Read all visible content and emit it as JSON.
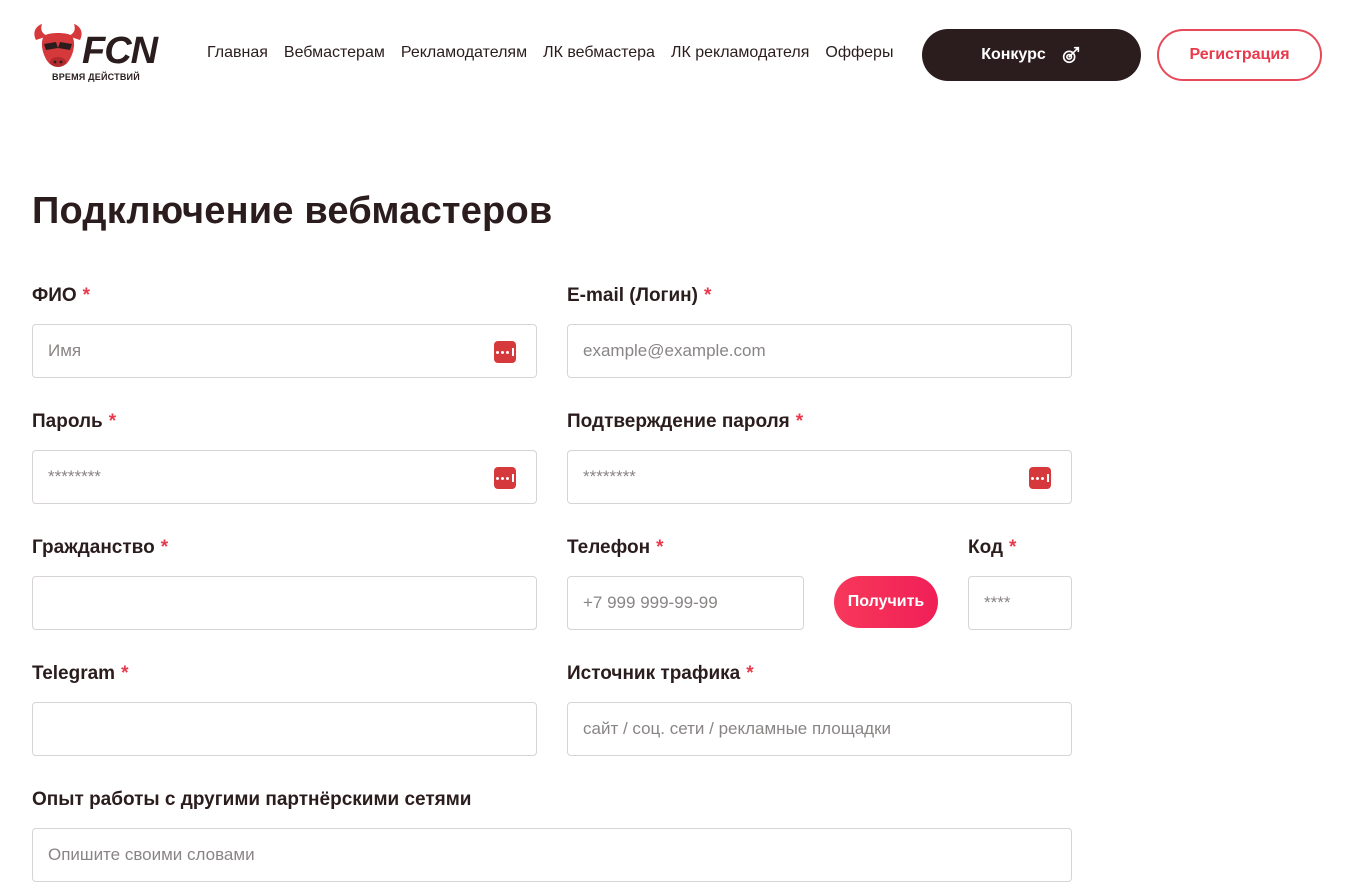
{
  "header": {
    "logo": {
      "brand": "FCN",
      "tagline": "ВРЕМЯ ДЕЙСТВИЙ"
    },
    "nav": [
      {
        "label": "Главная"
      },
      {
        "label": "Вебмастерам"
      },
      {
        "label": "Рекламодателям"
      },
      {
        "label": "ЛК вебмастера"
      },
      {
        "label": "ЛК рекламодателя"
      },
      {
        "label": "Офферы"
      }
    ],
    "contest_label": "Конкурс",
    "register_label": "Регистрация"
  },
  "page": {
    "title": "Подключение вебмастеров"
  },
  "form": {
    "required_mark": "*",
    "fio": {
      "label": "ФИО",
      "placeholder": "Имя",
      "value": ""
    },
    "email": {
      "label": "E-mail (Логин)",
      "placeholder": "example@example.com",
      "value": ""
    },
    "password": {
      "label": "Пароль",
      "placeholder": "********",
      "value": ""
    },
    "password_confirm": {
      "label": "Подтверждение пароля",
      "placeholder": "********",
      "value": ""
    },
    "citizenship": {
      "label": "Гражданство",
      "placeholder": "",
      "value": ""
    },
    "phone": {
      "label": "Телефон",
      "placeholder": "+7 999 999-99-99",
      "value": ""
    },
    "get_code_label": "Получить",
    "code": {
      "label": "Код",
      "placeholder": "****",
      "value": ""
    },
    "telegram": {
      "label": "Telegram",
      "placeholder": "",
      "value": ""
    },
    "traffic_source": {
      "label": "Источник трафика",
      "placeholder": "сайт / соц. сети / рекламные площадки",
      "value": ""
    },
    "experience": {
      "label": "Опыт работы с другими партнёрскими сетями",
      "placeholder": "Опишите своими словами",
      "value": ""
    }
  },
  "colors": {
    "accent": "#e83a4c",
    "dark": "#2b1d1d",
    "border": "#d9d4d4"
  }
}
